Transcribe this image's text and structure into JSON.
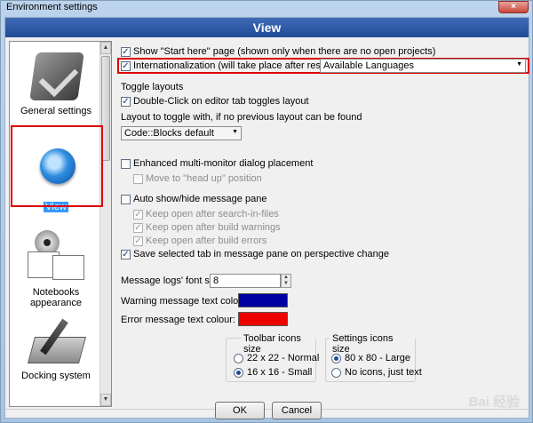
{
  "window": {
    "title": "Environment settings",
    "close_glyph": "×"
  },
  "header": {
    "title": "View"
  },
  "sidebar": {
    "items": [
      {
        "label": "General settings",
        "icon": "check-settings-icon"
      },
      {
        "label": "View",
        "icon": "eye-icon"
      },
      {
        "label": "Notebooks appearance",
        "icon": "notebooks-icon"
      },
      {
        "label": "Docking system",
        "icon": "docking-icon"
      }
    ],
    "scroll_up": "▲",
    "scroll_down": "▼"
  },
  "options": {
    "start_here": {
      "label": "Show \"Start here\" page (shown only when there are no open projects)",
      "checked": true
    },
    "internationalization": {
      "label": "Internationalization (will take place after restart)",
      "checked": true,
      "combo_value": "Available Languages"
    },
    "toggle_layouts_heading": "Toggle layouts",
    "double_click": {
      "label": "Double-Click on editor tab toggles layout",
      "checked": true
    },
    "layout_toggle_label": "Layout to toggle with, if no previous layout can be found",
    "layout_combo_value": "Code::Blocks default",
    "multi_monitor": {
      "label": "Enhanced multi-monitor dialog placement",
      "checked": false
    },
    "head_up": {
      "label": "Move to \"head up\" position",
      "checked": false
    },
    "auto_show_hide": {
      "label": "Auto show/hide message pane",
      "checked": false
    },
    "keep_search": {
      "label": "Keep open after search-in-files",
      "checked": true
    },
    "keep_warnings": {
      "label": "Keep open after build warnings",
      "checked": true
    },
    "keep_errors": {
      "label": "Keep open after build errors",
      "checked": true
    },
    "save_tab": {
      "label": "Save selected tab in message pane on perspective change",
      "checked": true
    },
    "font_size_label": "Message logs' font size:",
    "font_size_value": "8",
    "warning_colour_label": "Warning message text colour:",
    "warning_colour": "#0000a0",
    "error_colour_label": "Error message text colour:",
    "error_colour": "#ee0000"
  },
  "toolbar_icons": {
    "title": "Toolbar icons size",
    "options": [
      {
        "label": "22 x 22 - Normal",
        "selected": false
      },
      {
        "label": "16 x 16 - Small",
        "selected": true
      }
    ]
  },
  "settings_icons": {
    "title": "Settings icons size",
    "options": [
      {
        "label": "80 x 80 - Large",
        "selected": true
      },
      {
        "label": "No icons, just text",
        "selected": false
      }
    ]
  },
  "buttons": {
    "ok": "OK",
    "cancel": "Cancel"
  },
  "colors": {
    "highlight_box": "#dd0000",
    "selection": "#3399ff",
    "banner": "#2b5aa8"
  },
  "watermark": "Bai 经验"
}
